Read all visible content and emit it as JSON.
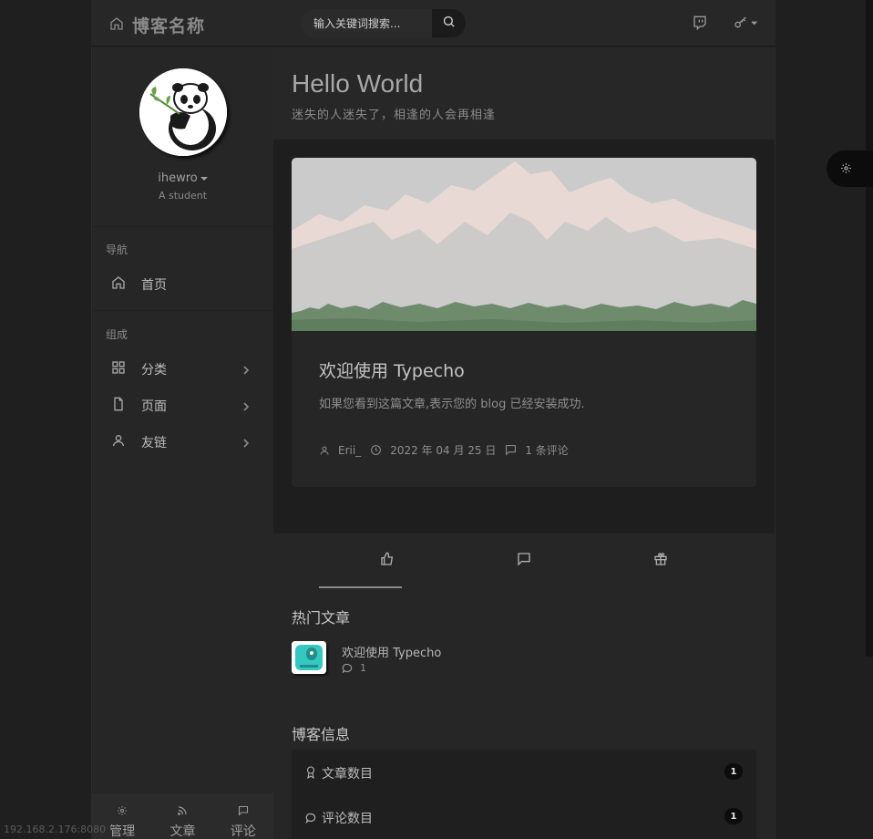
{
  "header": {
    "brand": "博客名称",
    "search_placeholder": "输入关键词搜索..."
  },
  "sidebar": {
    "username": "ihewro",
    "tagline": "A student",
    "nav_section": "导航",
    "nav_items": [
      {
        "label": "首页",
        "icon": "home-icon"
      }
    ],
    "compose_section": "组成",
    "compose_items": [
      {
        "label": "分类",
        "icon": "grid-icon"
      },
      {
        "label": "页面",
        "icon": "file-icon"
      },
      {
        "label": "友链",
        "icon": "user-icon"
      }
    ],
    "footer": [
      {
        "label": "管理",
        "icon": "gear-icon"
      },
      {
        "label": "文章",
        "icon": "rss-icon"
      },
      {
        "label": "评论",
        "icon": "comment-icon"
      }
    ]
  },
  "status_url": "192.168.2.176:8080",
  "main": {
    "title": "Hello World",
    "subtitle": "迷失的人迷失了，相逢的人会再相逢"
  },
  "post": {
    "title": "欢迎使用 Typecho",
    "excerpt": "如果您看到这篇文章,表示您的 blog 已经安装成功.",
    "author": "Erii_",
    "date": "2022 年 04 月 25 日",
    "comments": "1 条评论"
  },
  "widgets": {
    "tabs": [
      "thumbs-up-icon",
      "comment-icon",
      "gift-icon"
    ],
    "hot_title": "热门文章",
    "hot_posts": [
      {
        "title": "欢迎使用 Typecho",
        "comments": "1"
      }
    ],
    "info_title": "博客信息",
    "info": [
      {
        "label": "文章数目",
        "value": "1",
        "icon": "award-icon"
      },
      {
        "label": "评论数目",
        "value": "1",
        "icon": "comment-icon"
      }
    ]
  },
  "colors": {
    "background": "#1f1f1f",
    "panel": "#262626",
    "banner_sky": "#cbcbcb",
    "banner_snow": "#e8d9d4",
    "forest": "#6e8c6b"
  }
}
